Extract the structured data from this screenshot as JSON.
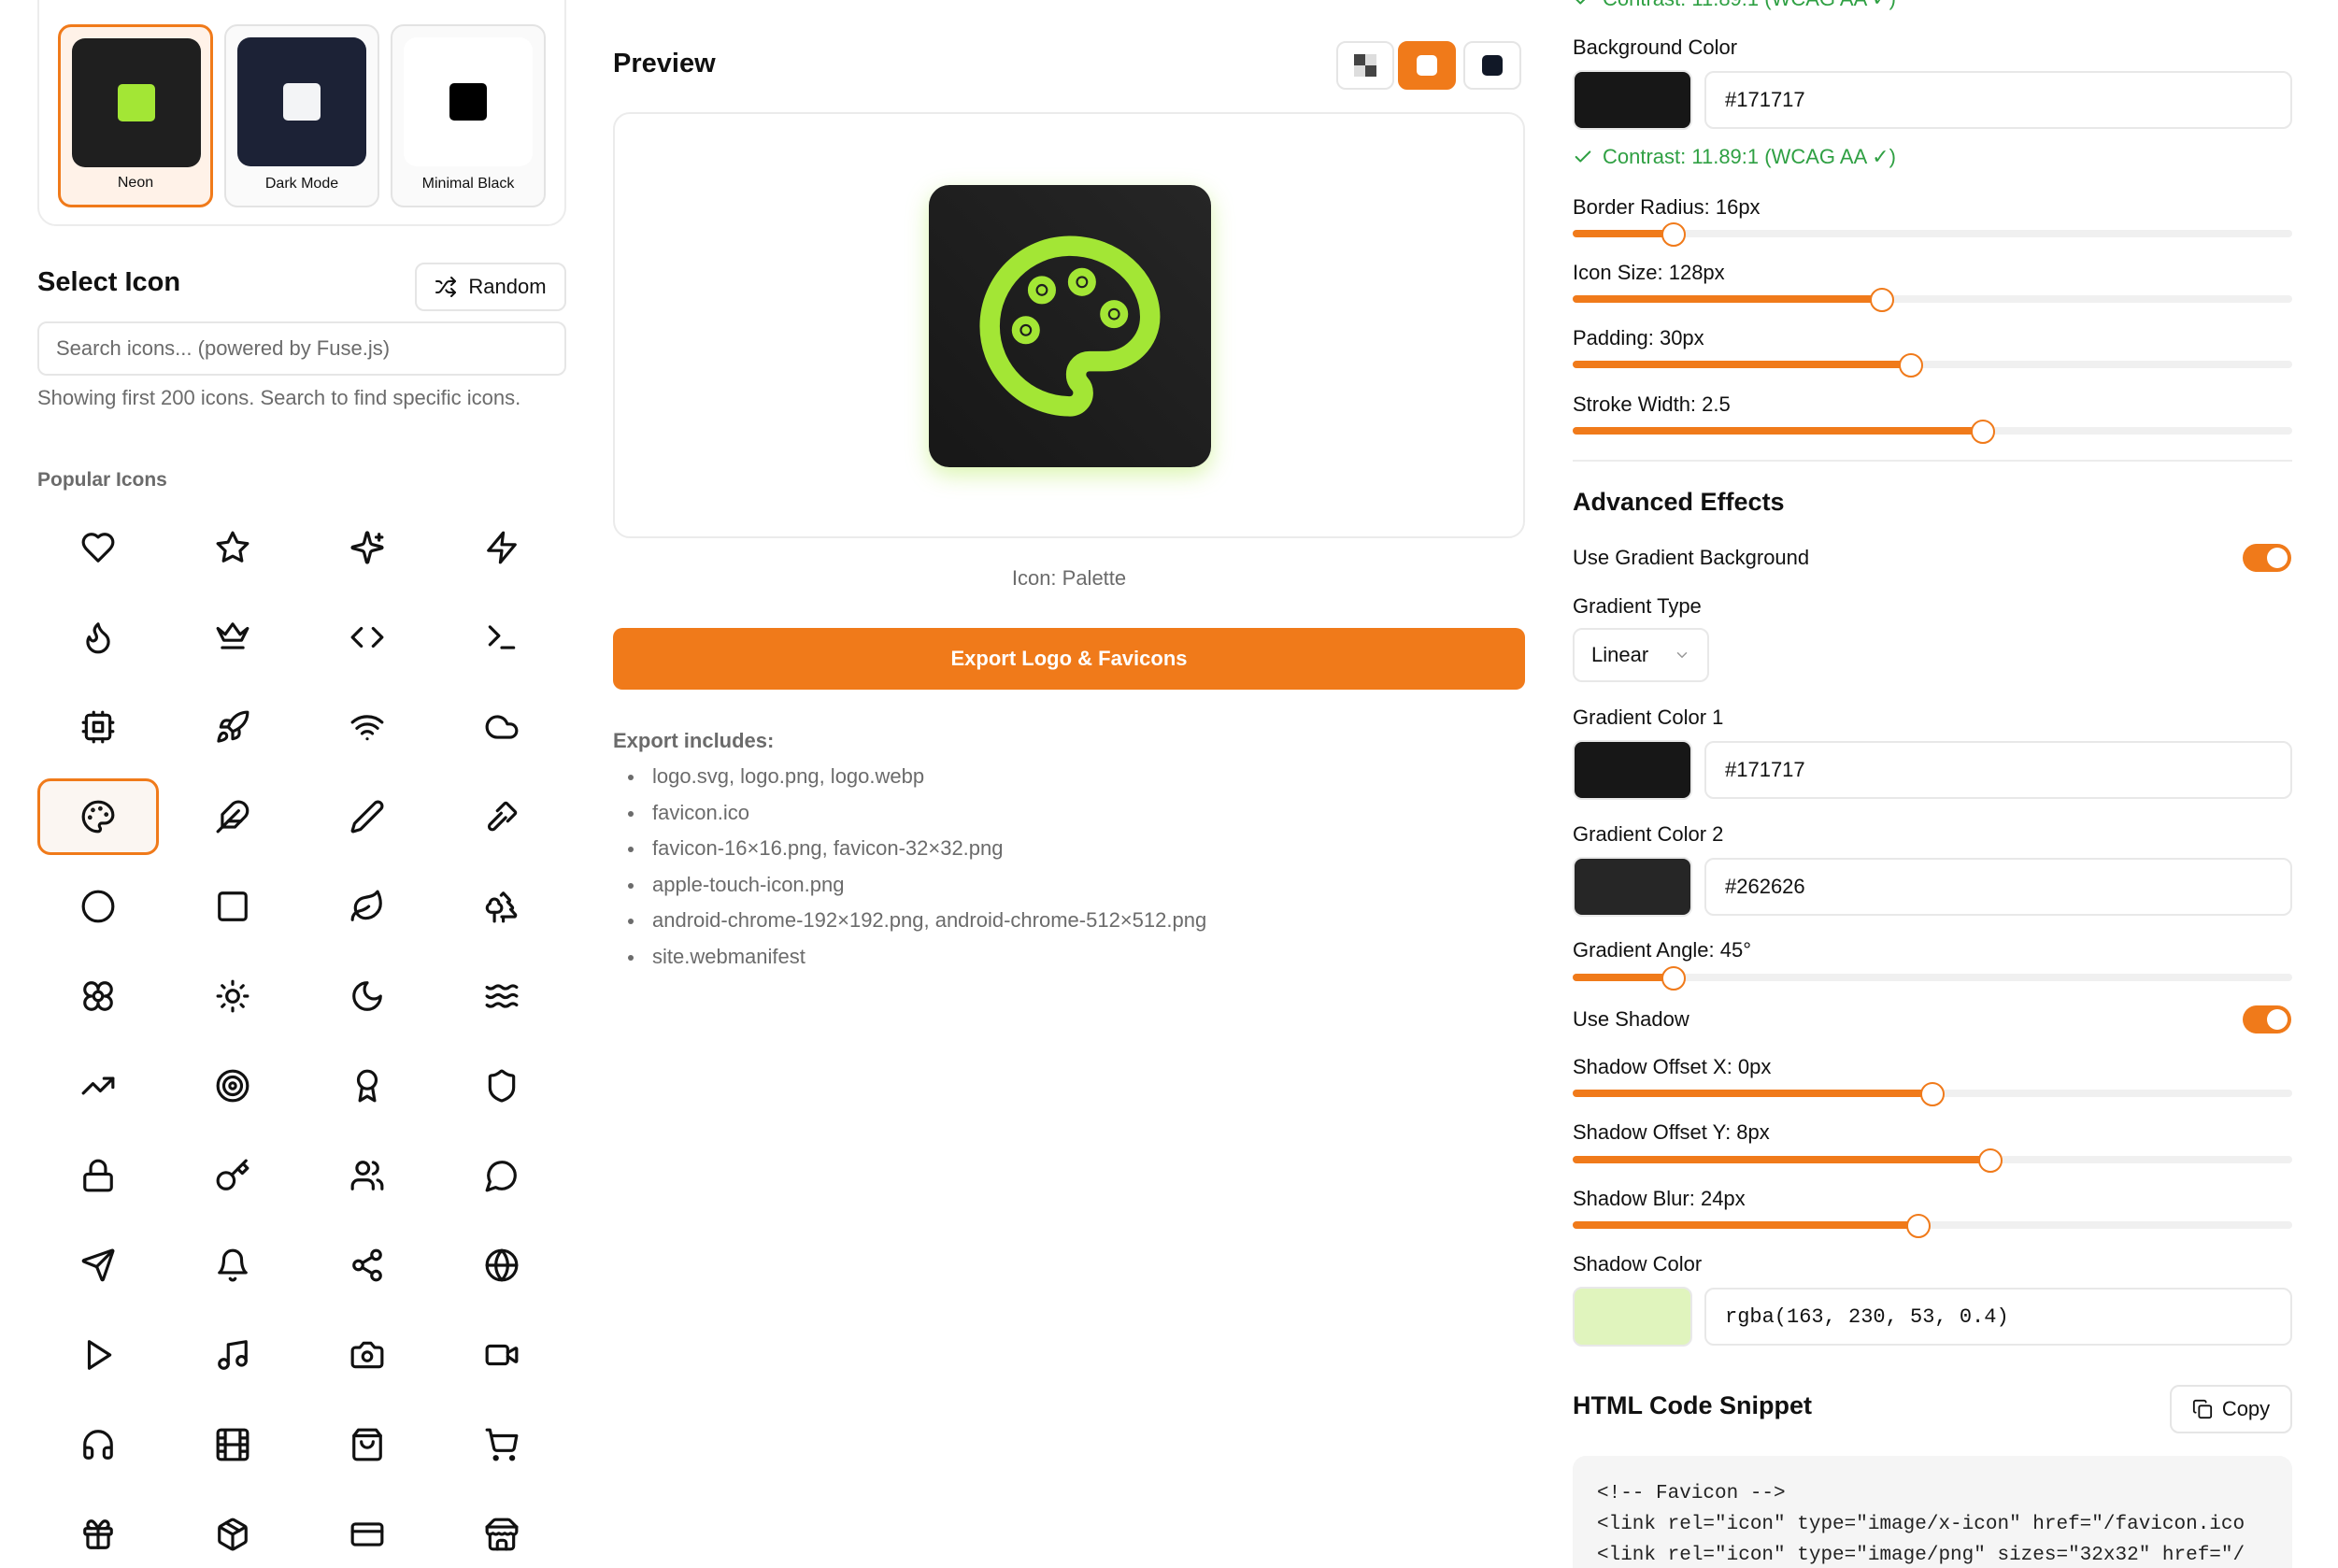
{
  "themes": [
    {
      "label": "Neon",
      "tile_color": "#1f1f1f",
      "dot_color": "#a3e635",
      "selected": true
    },
    {
      "label": "Dark Mode",
      "tile_color": "#1c2236",
      "dot_color": "#f3f4f6",
      "selected": false
    },
    {
      "label": "Minimal Black",
      "tile_color": "#ffffff",
      "dot_color": "#000000",
      "selected": false
    }
  ],
  "select_icon": {
    "title": "Select Icon",
    "random_label": "Random",
    "search_placeholder": "Search icons... (powered by Fuse.js)",
    "showing_text": "Showing first 200 icons. Search to find specific icons.",
    "popular_title": "Popular Icons",
    "icons": [
      "heart",
      "star",
      "sparkles",
      "zap",
      "flame",
      "crown",
      "code",
      "terminal",
      "cpu",
      "rocket",
      "wifi",
      "cloud",
      "palette",
      "feather",
      "pencil",
      "paintbrush",
      "circle",
      "square",
      "leaf",
      "trees",
      "flower",
      "sun",
      "moon",
      "waves",
      "trending-up",
      "target",
      "award",
      "shield",
      "lock",
      "key",
      "users",
      "message-circle",
      "send",
      "bell",
      "share",
      "globe",
      "play",
      "music",
      "camera",
      "video",
      "headphones",
      "film",
      "shopping-bag",
      "shopping-cart",
      "gift",
      "package",
      "credit-card",
      "store"
    ],
    "selected_icon": "palette"
  },
  "preview": {
    "title": "Preview",
    "bg_options": [
      "transparent",
      "light",
      "dark"
    ],
    "active_bg": "light",
    "icon_caption": "Icon: Palette",
    "export_button": "Export Logo & Favicons",
    "export_includes_title": "Export includes:",
    "export_items": [
      "logo.svg, logo.png, logo.webp",
      "favicon.ico",
      "favicon-16×16.png, favicon-32×32.png",
      "apple-touch-icon.png",
      "android-chrome-192×192.png, android-chrome-512×512.png",
      "site.webmanifest"
    ]
  },
  "settings": {
    "contrast_top": "Contrast: 11.89:1 (WCAG AA ✓)",
    "background_color_label": "Background Color",
    "background_color": "#171717",
    "contrast": "Contrast: 11.89:1 (WCAG AA ✓)",
    "border_radius_label": "Border Radius: 16px",
    "border_radius_level": 0.14,
    "icon_size_label": "Icon Size: 128px",
    "icon_size_level": 0.43,
    "padding_label": "Padding: 30px",
    "padding_level": 0.47,
    "stroke_width_label": "Stroke Width: 2.5",
    "stroke_width_level": 0.57,
    "advanced_title": "Advanced Effects",
    "use_gradient_label": "Use Gradient Background",
    "use_gradient": true,
    "gradient_type_label": "Gradient Type",
    "gradient_type": "Linear",
    "gradient_color1_label": "Gradient Color 1",
    "gradient_color1": "#171717",
    "gradient_color2_label": "Gradient Color 2",
    "gradient_color2": "#262626",
    "gradient_angle_label": "Gradient Angle: 45°",
    "gradient_angle_level": 0.14,
    "use_shadow_label": "Use Shadow",
    "use_shadow": true,
    "shadow_x_label": "Shadow Offset X: 0px",
    "shadow_x_level": 0.5,
    "shadow_y_label": "Shadow Offset Y: 8px",
    "shadow_y_level": 0.58,
    "shadow_blur_label": "Shadow Blur: 24px",
    "shadow_blur_level": 0.48,
    "shadow_color_label": "Shadow Color",
    "shadow_color": "rgba(163, 230, 53, 0.4)",
    "shadow_swatch": "#e0f4bd",
    "accent": "#f07a1a"
  },
  "code": {
    "title": "HTML Code Snippet",
    "copy_label": "Copy",
    "lines": [
      "<!-- Favicon -->",
      "<link rel=\"icon\" type=\"image/x-icon\" href=\"/favicon.ico",
      "<link rel=\"icon\" type=\"image/png\" sizes=\"32x32\" href=\"/"
    ]
  }
}
